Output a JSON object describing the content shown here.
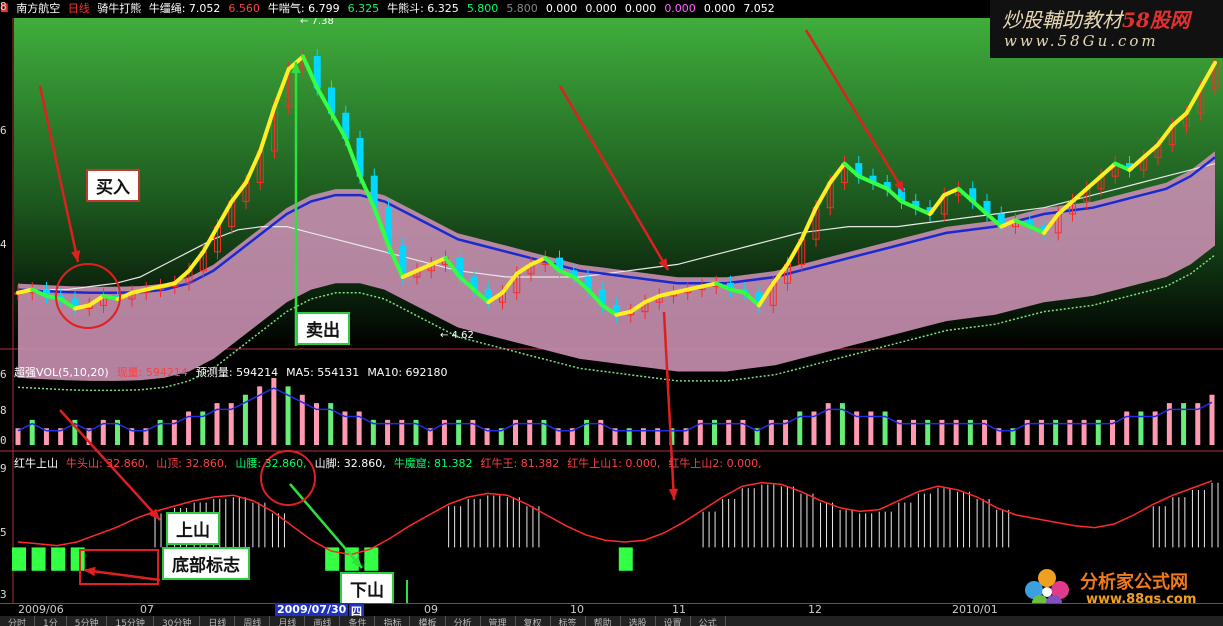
{
  "chart_data": {
    "type": "candlestick",
    "main_header": {
      "stock": "南方航空",
      "period": "日线",
      "indicator": "骑牛打熊",
      "items": [
        {
          "label": "牛缰绳: 7.052",
          "color": "#ffffff"
        },
        {
          "label": "6.560",
          "color": "#ff4040"
        },
        {
          "label": "牛喘气: 6.799",
          "color": "#ffffff"
        },
        {
          "label": "6.325",
          "color": "#00ff66"
        },
        {
          "label": "牛熊斗: 6.325",
          "color": "#ffffff"
        },
        {
          "label": "5.800",
          "color": "#00ff66"
        },
        {
          "label": "5.800",
          "color": "#888888"
        },
        {
          "label": "0.000",
          "color": "#ffffff"
        },
        {
          "label": "0.000",
          "color": "#ffffff"
        },
        {
          "label": "0.000",
          "color": "#ffffff"
        },
        {
          "label": "0.000",
          "color": "#ff66ff"
        },
        {
          "label": "0.000",
          "color": "#ffffff"
        },
        {
          "label": "7.052",
          "color": "#ffffff"
        }
      ]
    },
    "main_yticks": [
      "8",
      "6",
      "4"
    ],
    "main_annotations": [
      "7.38",
      "4.62"
    ],
    "x_ticks": [
      "2009/06",
      "07",
      "2009/07/30",
      "四",
      "09",
      "10",
      "11",
      "12",
      "2010/01"
    ],
    "volume_panel": {
      "items": [
        {
          "label": "超强VOL(5,10,20)",
          "color": "#ffffff"
        },
        {
          "label": "现量: 594214",
          "color": "#ff4040"
        },
        {
          "label": "预测量: 594214",
          "color": "#ffffff"
        },
        {
          "label": "MA5: 554131",
          "color": "#ffffff"
        },
        {
          "label": "MA10: 692180",
          "color": "#ffffff"
        }
      ],
      "yticks": [
        "6",
        "8",
        "0"
      ]
    },
    "indicator_panel": {
      "items": [
        {
          "label": "红牛上山",
          "color": "#ffffff"
        },
        {
          "label": "牛头山: 32.860,",
          "color": "#ff4040"
        },
        {
          "label": "山顶: 32.860,",
          "color": "#ff4040"
        },
        {
          "label": "山腰: 32.860,",
          "color": "#00ff66"
        },
        {
          "label": "山脚: 32.860,",
          "color": "#ffffff"
        },
        {
          "label": "牛魔窟: 81.382",
          "color": "#00ff66"
        },
        {
          "label": "红牛王: 81.382",
          "color": "#ff4040"
        },
        {
          "label": "红牛上山1: 0.000,",
          "color": "#ff4040"
        },
        {
          "label": "红牛上山2: 0.000,",
          "color": "#ff4040"
        }
      ],
      "yticks": [
        "9",
        "5",
        "3"
      ]
    },
    "price_series": [
      3.55,
      3.6,
      3.5,
      3.45,
      3.3,
      3.35,
      3.5,
      3.45,
      3.55,
      3.6,
      3.65,
      3.7,
      3.9,
      4.2,
      4.6,
      5.0,
      5.3,
      5.8,
      6.5,
      7.1,
      7.3,
      6.8,
      6.4,
      6.0,
      5.4,
      4.9,
      4.3,
      3.8,
      3.9,
      4.0,
      4.1,
      3.8,
      3.6,
      3.4,
      3.55,
      3.85,
      4.0,
      4.1,
      3.9,
      3.8,
      3.6,
      3.35,
      3.2,
      3.25,
      3.4,
      3.5,
      3.55,
      3.6,
      3.65,
      3.7,
      3.6,
      3.55,
      3.35,
      3.7,
      4.0,
      4.4,
      4.9,
      5.3,
      5.6,
      5.4,
      5.3,
      5.2,
      5.0,
      4.9,
      4.8,
      5.1,
      5.2,
      5.0,
      4.8,
      4.6,
      4.7,
      4.6,
      4.5,
      4.8,
      5.0,
      5.2,
      5.4,
      5.6,
      5.5,
      5.7,
      5.9,
      6.2,
      6.4,
      6.8,
      7.2
    ],
    "ma_blue": [
      3.6,
      3.58,
      3.56,
      3.55,
      3.55,
      3.56,
      3.6,
      3.7,
      3.9,
      4.2,
      4.5,
      4.8,
      5.0,
      5.1,
      5.1,
      5.0,
      4.8,
      4.6,
      4.4,
      4.3,
      4.2,
      4.1,
      4.0,
      3.9,
      3.85,
      3.8,
      3.75,
      3.7,
      3.7,
      3.7,
      3.75,
      3.8,
      3.9,
      4.0,
      4.1,
      4.2,
      4.3,
      4.4,
      4.5,
      4.55,
      4.6,
      4.7,
      4.8,
      4.85,
      4.9,
      5.0,
      5.1,
      5.2,
      5.4,
      5.7
    ],
    "ma_white": [
      3.6,
      3.6,
      3.6,
      3.65,
      3.7,
      3.8,
      4.0,
      4.2,
      4.4,
      4.55,
      4.6,
      4.6,
      4.5,
      4.4,
      4.3,
      4.2,
      4.1,
      4.0,
      3.9,
      3.85,
      3.8,
      3.8,
      3.8,
      3.8,
      3.85,
      3.9,
      3.95,
      4.0,
      4.1,
      4.2,
      4.3,
      4.4,
      4.5,
      4.55,
      4.6,
      4.6,
      4.6,
      4.65,
      4.7,
      4.75,
      4.8,
      4.85,
      4.9,
      5.0,
      5.1,
      5.2,
      5.3,
      5.4,
      5.5,
      5.6
    ],
    "volume_values": [
      2,
      3,
      2,
      2,
      3,
      2,
      3,
      3,
      2,
      2,
      3,
      3,
      4,
      4,
      5,
      5,
      6,
      7,
      8,
      7,
      6,
      5,
      5,
      4,
      4,
      3,
      3,
      3,
      3,
      2,
      3,
      3,
      3,
      2,
      2,
      3,
      3,
      3,
      2,
      2,
      3,
      3,
      2,
      2,
      2,
      2,
      2,
      2,
      3,
      3,
      3,
      3,
      2,
      3,
      3,
      4,
      4,
      5,
      5,
      4,
      4,
      4,
      3,
      3,
      3,
      3,
      3,
      3,
      3,
      2,
      2,
      3,
      3,
      3,
      3,
      3,
      3,
      3,
      4,
      4,
      4,
      5,
      5,
      5,
      6
    ],
    "indicator_red_line": [
      5.5,
      5.4,
      5.3,
      5.5,
      5.9,
      6.3,
      6.8,
      7.2,
      7.5,
      7.8,
      8.0,
      8.1,
      7.8,
      7.2,
      6.4,
      5.6,
      5.0,
      4.8,
      5.1,
      5.7,
      6.4,
      7.0,
      7.6,
      8.0,
      8.2,
      8.1,
      7.6,
      7.0,
      6.4,
      5.9,
      5.6,
      5.5,
      5.6,
      6.0,
      6.6,
      7.3,
      8.0,
      8.6,
      8.8,
      8.7,
      8.3,
      7.8,
      7.4,
      7.2,
      7.3,
      7.8,
      8.3,
      8.6,
      8.4,
      8.0,
      7.4,
      7.0,
      6.8,
      6.6,
      6.4,
      6.3,
      6.5,
      7.0,
      7.6,
      8.1,
      8.5,
      8.9
    ],
    "callouts": [
      "买入",
      "卖出",
      "上山",
      "底部标志",
      "下山"
    ]
  },
  "watermark": {
    "site_title": "炒股輔助教材58股网",
    "site_title_highlight": "58股网",
    "site_url": "www.58Gu.com",
    "logo_name": "分析家公式网",
    "logo_url": "www.88gs.com"
  },
  "bottom_tabs": [
    "分时",
    "1分",
    "5分钟",
    "15分钟",
    "30分钟",
    "日线",
    "周线",
    "月线",
    "画线",
    "条件",
    "指标",
    "模板",
    "分析",
    "管理",
    "复权",
    "标签",
    "帮助",
    "选股",
    "设置",
    "公式"
  ]
}
